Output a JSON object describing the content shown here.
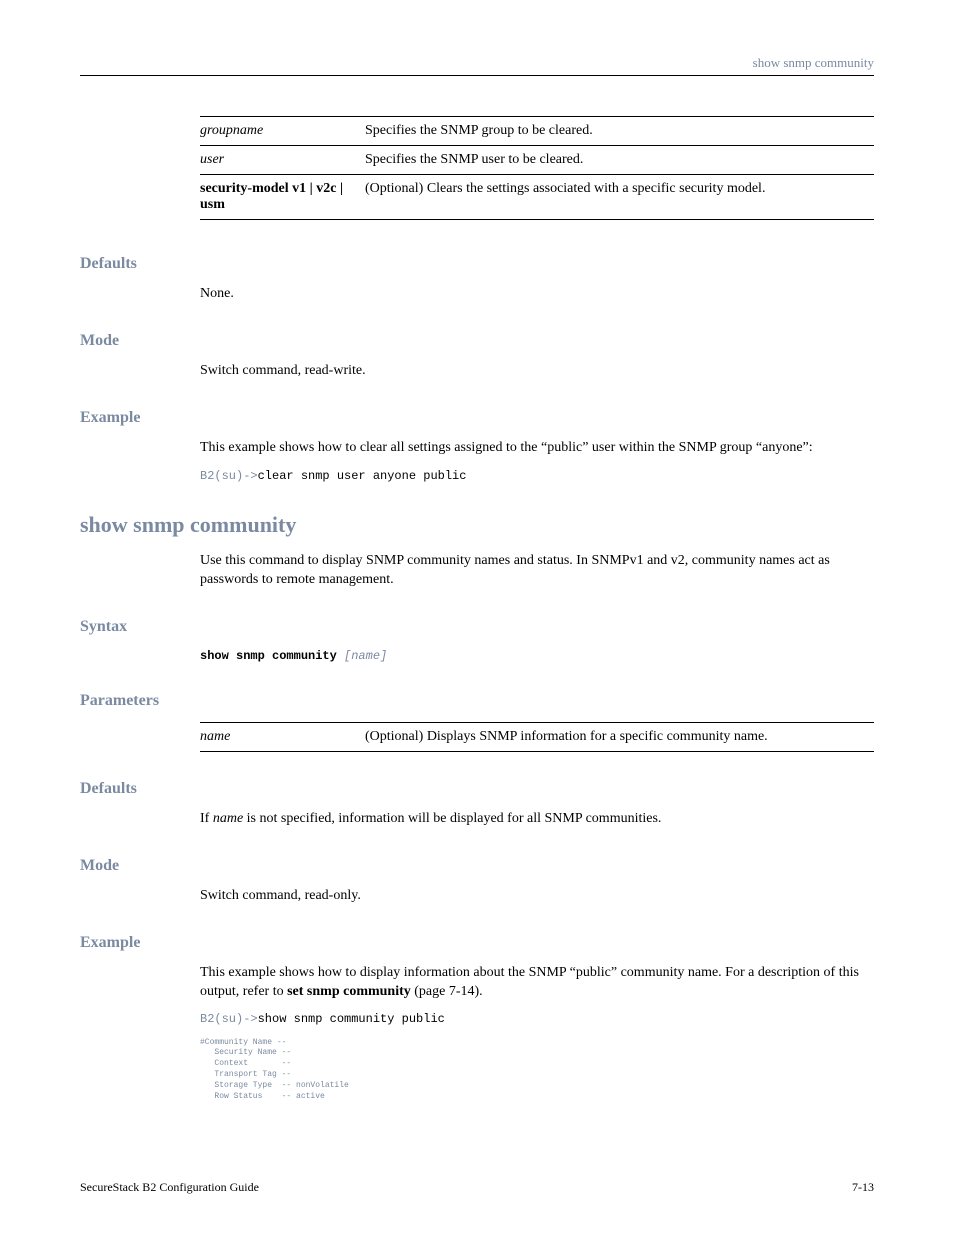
{
  "header": {
    "section": "show snmp community"
  },
  "paramTable1": {
    "rows": [
      {
        "param": "groupname",
        "paramStyle": "italic",
        "desc": "Specifies the SNMP group to be cleared."
      },
      {
        "param": "user",
        "paramStyle": "italic",
        "desc": "Specifies the SNMP user to be cleared."
      },
      {
        "param": "security-model v1 | v2c | usm",
        "paramStyle": "bold",
        "desc": "(Optional) Clears the settings associated with a specific security model."
      }
    ]
  },
  "sections1": {
    "defaults": {
      "heading": "Defaults",
      "body": "None."
    },
    "mode": {
      "heading": "Mode",
      "body": "Switch command, read-write."
    },
    "example": {
      "heading": "Example",
      "intro": "This example shows how to clear all settings assigned to the “public” user within the SNMP group “anyone”:",
      "code_prompt": "B2(su)->",
      "code_cmd": "clear snmp user anyone public"
    }
  },
  "command2": {
    "title": "show snmp community",
    "description": "Use this command to display SNMP community names and status. In SNMPv1 and v2, community names act as passwords to remote management.",
    "syntax": {
      "heading": "Syntax",
      "code_cmd": "show snmp community",
      "code_args": " [name]"
    },
    "parameters": {
      "heading": "Parameters",
      "rows": [
        {
          "param": "name",
          "desc": "(Optional) Displays SNMP information for a specific community name."
        }
      ]
    },
    "defaults": {
      "heading": "Defaults",
      "body_prefix": "If ",
      "body_italic": "name",
      "body_suffix": " is not specified, information will be displayed for all SNMP communities."
    },
    "mode": {
      "heading": "Mode",
      "body": "Switch command, read-only."
    },
    "example": {
      "heading": "Example",
      "intro_pre": "This example shows how to display information about the SNMP “public” community name. For a description of this output, refer to ",
      "intro_bold": "set snmp community",
      "intro_post": " (page 7-14).",
      "code_prompt": "B2(su)->",
      "code_cmd": "show snmp community public",
      "output": "#Community Name --\n   Security Name --\n   Context       --\n   Transport Tag --\n   Storage Type  -- nonVolatile\n   Row Status    -- active"
    }
  },
  "footer": {
    "left": "SecureStack B2 Configuration Guide",
    "right": "7-13"
  }
}
